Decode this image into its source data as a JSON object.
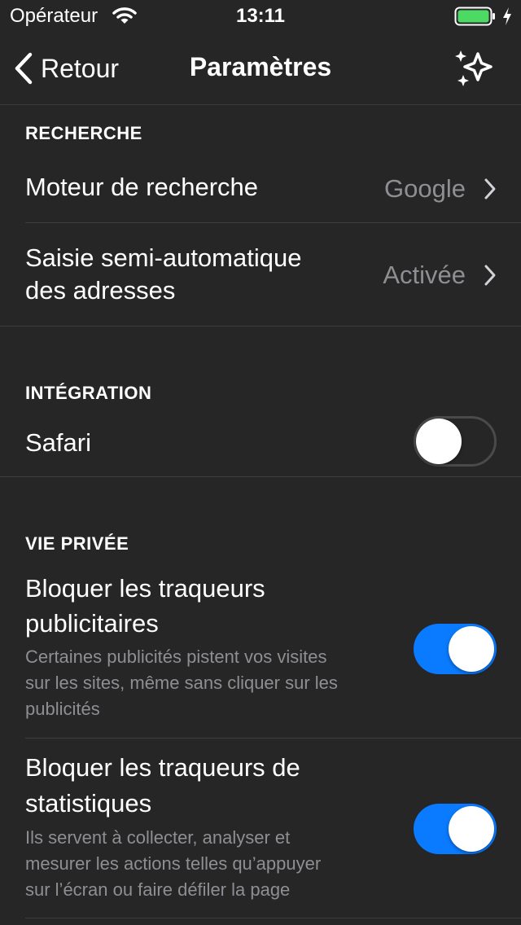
{
  "status_bar": {
    "carrier": "Opérateur",
    "time": "13:11",
    "battery_color": "#4cd964"
  },
  "nav": {
    "back_label": "Retour",
    "title": "Paramètres",
    "action_icon": "sparkles-icon"
  },
  "sections": {
    "search": {
      "header": "RECHERCHE",
      "engine": {
        "label": "Moteur de recherche",
        "value": "Google"
      },
      "autocomplete": {
        "label_line1": "Saisie semi-automatique",
        "label_line2": "des adresses",
        "value": "Activée"
      }
    },
    "integration": {
      "header": "INTÉGRATION",
      "safari": {
        "label": "Safari",
        "enabled": false
      }
    },
    "privacy": {
      "header": "VIE PRIVÉE",
      "ad_trackers": {
        "title_line1": "Bloquer les traqueurs",
        "title_line2": "publicitaires",
        "desc_line1": "Certaines publicités pistent vos visites",
        "desc_line2": "sur les sites, même sans cliquer sur les",
        "desc_line3": "publicités",
        "enabled": true
      },
      "stats_trackers": {
        "title_line1": "Bloquer les traqueurs de",
        "title_line2": "statistiques",
        "desc_line1": "Ils servent à collecter, analyser et",
        "desc_line2": "mesurer les actions telles qu’appuyer",
        "desc_line3": "sur l’écran ou faire défiler la page",
        "enabled": true
      }
    }
  },
  "colors": {
    "background": "#262626",
    "accent": "#0a7aff",
    "secondary_text": "#8e8e93"
  }
}
